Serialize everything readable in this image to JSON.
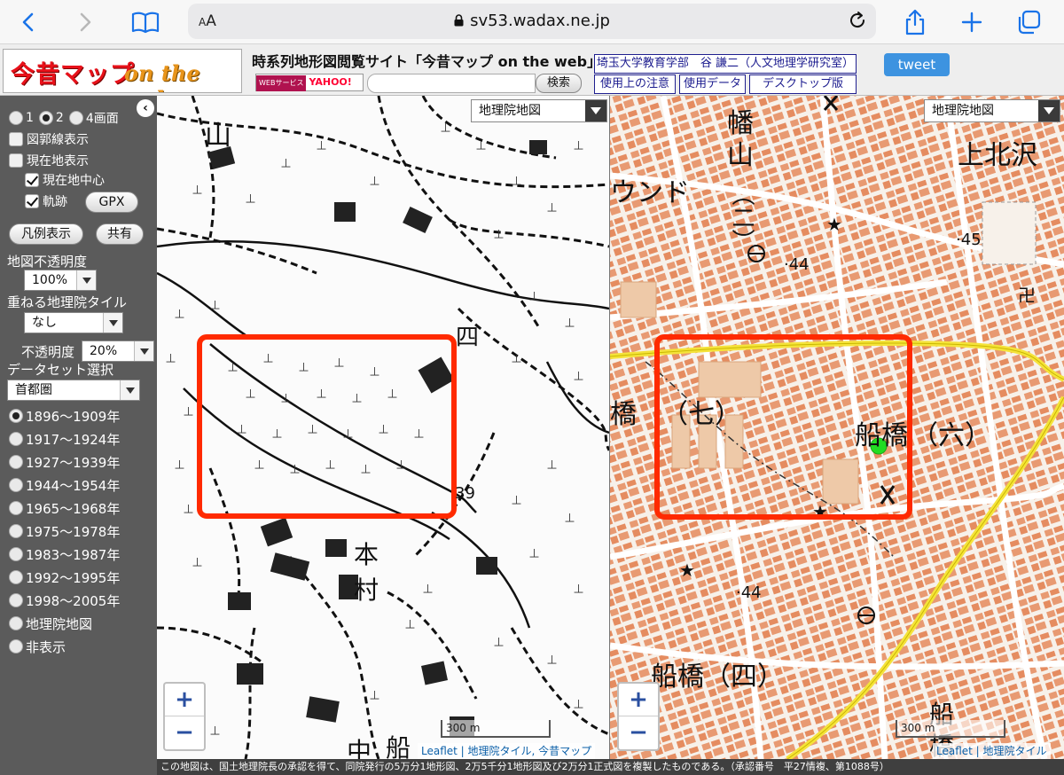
{
  "browser": {
    "address_aa": "AA",
    "url": "sv53.wadax.ne.jp"
  },
  "header": {
    "logo_main": "今昔マップ",
    "logo_sub": "on the web",
    "site_title": "時系列地形図閲覧サイト「今昔マップ on the web」",
    "yahoo_badge_left": "WEBサービス",
    "yahoo_badge_right": "YAHOO!",
    "search_placeholder": "",
    "search_button": "検索",
    "author_link": "埼玉大学教育学部　谷 謙二（人文地理学研究室）",
    "usage_link": "使用上の注意",
    "data_link": "使用データ",
    "desktop_link": "デスクトップ版",
    "tweet": "tweet"
  },
  "panel": {
    "screens": [
      {
        "label": "1",
        "selected": false
      },
      {
        "label": "2",
        "selected": true
      },
      {
        "label": "4画面",
        "selected": false
      }
    ],
    "graticule": "図郭線表示",
    "current_location": "現在地表示",
    "center_on_location": "現在地中心",
    "track": "軌跡",
    "gpx_button": "GPX",
    "legend_button": "凡例表示",
    "share_button": "共有",
    "opacity_label": "地図不透明度",
    "opacity_value": "100%",
    "overlay_label": "重ねる地理院タイル",
    "overlay_value": "なし",
    "overlay_opacity_label": "不透明度",
    "overlay_opacity_value": "20%",
    "dataset_label": "データセット選択",
    "dataset_value": "首都圏",
    "periods": [
      {
        "label": "1896〜1909年",
        "selected": true
      },
      {
        "label": "1917〜1924年",
        "selected": false
      },
      {
        "label": "1927〜1939年",
        "selected": false
      },
      {
        "label": "1944〜1954年",
        "selected": false
      },
      {
        "label": "1965〜1968年",
        "selected": false
      },
      {
        "label": "1975〜1978年",
        "selected": false
      },
      {
        "label": "1983〜1987年",
        "selected": false
      },
      {
        "label": "1992〜1995年",
        "selected": false
      },
      {
        "label": "1998〜2005年",
        "selected": false
      },
      {
        "label": "地理院地図",
        "selected": false
      },
      {
        "label": "非表示",
        "selected": false
      }
    ],
    "collapse": "‹"
  },
  "map_left": {
    "layer_select": "地理院地図",
    "labels": {
      "yama": "山",
      "shi": "四",
      "hon": "本",
      "mura": "村",
      "naka": "中",
      "fune": "船"
    },
    "spot_height": "39",
    "zoom_in": "+",
    "zoom_out": "−",
    "scale": "300 m",
    "attribution": "Leaflet | 地理院タイル, 今昔マップ"
  },
  "map_right": {
    "layer_select": "地理院地図",
    "labels": {
      "hata": "幡",
      "yama": "山",
      "kamikitazawa": "上北沢",
      "uundo": "ウンド",
      "ni": "（二）",
      "nana": "（七）",
      "hashi": "橋",
      "funabashi6": "船橋",
      "roku": "（六）",
      "funabashi4": "船橋（四）",
      "fune_bottom": "船",
      "hashi_bottom": "橋"
    },
    "heights": {
      "h1": "44",
      "h2": "45",
      "h3": "44"
    },
    "zoom_in": "+",
    "zoom_out": "−",
    "scale": "300 m",
    "attribution": "Leaflet | 地理院タイル"
  },
  "footer": "この地図は、国土地理院長の承認を得て、同院発行の5万分1地形図、2万5千分1地形図及び2万分1正式図を複製したものである。（承認番号　平27情複、第1088号）"
}
